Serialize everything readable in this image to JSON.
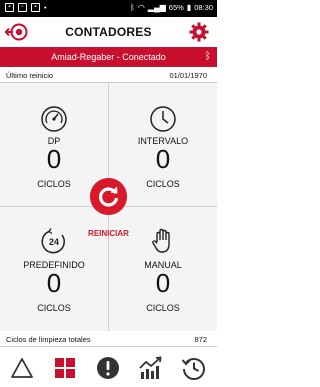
{
  "status_bar": {
    "battery": "65%",
    "time": "08:30"
  },
  "app_bar": {
    "title": "CONTADORES",
    "back_icon": "exit-arrow-icon",
    "settings_icon": "gear-icon"
  },
  "connection": {
    "label": "Amiad-Regaber - Conectado",
    "icon": "bluetooth-icon"
  },
  "last_reset": {
    "label": "Último reinicio",
    "value": "01/01/1970"
  },
  "counters": [
    {
      "name": "DP",
      "value": "0",
      "unit": "CICLOS",
      "icon": "gauge-icon"
    },
    {
      "name": "INTERVALO",
      "value": "0",
      "unit": "CICLOS",
      "icon": "clock-icon"
    },
    {
      "name": "PREDEFINIDO",
      "value": "0",
      "unit": "CICLOS",
      "icon": "timer-24-icon"
    },
    {
      "name": "MANUAL",
      "value": "0",
      "unit": "CICLOS",
      "icon": "hand-icon"
    }
  ],
  "timer_icon_text": "24",
  "reset": {
    "label": "REINICIAR",
    "icon": "refresh-icon"
  },
  "total": {
    "label": "Ciclos de limpieza totales",
    "value": "872"
  },
  "bottom_nav": [
    {
      "icon": "delta-icon",
      "active": false
    },
    {
      "icon": "grid-icon",
      "active": true
    },
    {
      "icon": "alert-icon",
      "active": false
    },
    {
      "icon": "trend-chart-icon",
      "active": false
    },
    {
      "icon": "history-icon",
      "active": false
    }
  ],
  "colors": {
    "accent": "#c8102e",
    "reset_button": "#d7192a",
    "grid_bg": "#f4f4f4"
  }
}
